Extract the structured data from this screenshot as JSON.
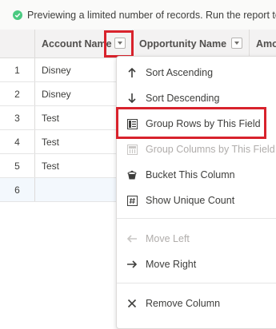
{
  "banner": {
    "text": "Previewing a limited number of records. Run the report to see everything."
  },
  "columns": [
    {
      "label": "Account Name"
    },
    {
      "label": "Opportunity Name"
    },
    {
      "label": "Amount"
    }
  ],
  "rows": [
    {
      "num": "1",
      "account": "Disney"
    },
    {
      "num": "2",
      "account": "Disney"
    },
    {
      "num": "3",
      "account": "Test"
    },
    {
      "num": "4",
      "account": "Test"
    },
    {
      "num": "5",
      "account": "Test"
    },
    {
      "num": "6",
      "account": ""
    }
  ],
  "menu": {
    "items": [
      {
        "label": "Sort Ascending",
        "icon": "arrow-up-icon",
        "disabled": false
      },
      {
        "label": "Sort Descending",
        "icon": "arrow-down-icon",
        "disabled": false
      },
      {
        "label": "Group Rows by This Field",
        "icon": "group-rows-icon",
        "disabled": false
      },
      {
        "label": "Group Columns by This Field",
        "icon": "group-columns-icon",
        "disabled": true
      },
      {
        "label": "Bucket This Column",
        "icon": "bucket-icon",
        "disabled": false
      },
      {
        "label": "Show Unique Count",
        "icon": "hash-icon",
        "disabled": false
      },
      {
        "label": "Move Left",
        "icon": "arrow-left-icon",
        "disabled": true
      },
      {
        "label": "Move Right",
        "icon": "arrow-right-icon",
        "disabled": false
      },
      {
        "label": "Remove Column",
        "icon": "close-icon",
        "disabled": false
      }
    ]
  },
  "colors": {
    "highlight": "#d8222c",
    "success": "#4bca81",
    "header_bg": "#f3f2f2"
  }
}
